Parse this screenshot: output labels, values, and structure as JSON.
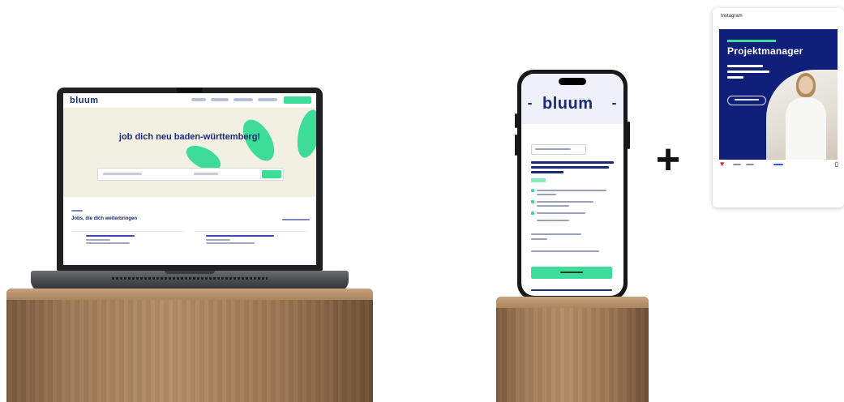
{
  "laptop": {
    "logo": "bluum",
    "hero_title": "job dich neu baden-württemberg!",
    "results_title": "Jobs, die dich weiterbringen",
    "colors": {
      "brand": "#1a2a7a",
      "accent": "#3ddc97",
      "hero_bg": "#f2efe3"
    }
  },
  "phone": {
    "logo": "bluum",
    "colors": {
      "brand": "#1a2a7a",
      "accent": "#3ddc97"
    }
  },
  "plus_sign": "+",
  "instagram": {
    "header": "Instagram",
    "post_title": "Projektmanager",
    "heart_icon": "heart-icon",
    "colors": {
      "post_bg": "#0f1f7a",
      "accent": "#3ddc97",
      "like": "#e21f35"
    }
  }
}
